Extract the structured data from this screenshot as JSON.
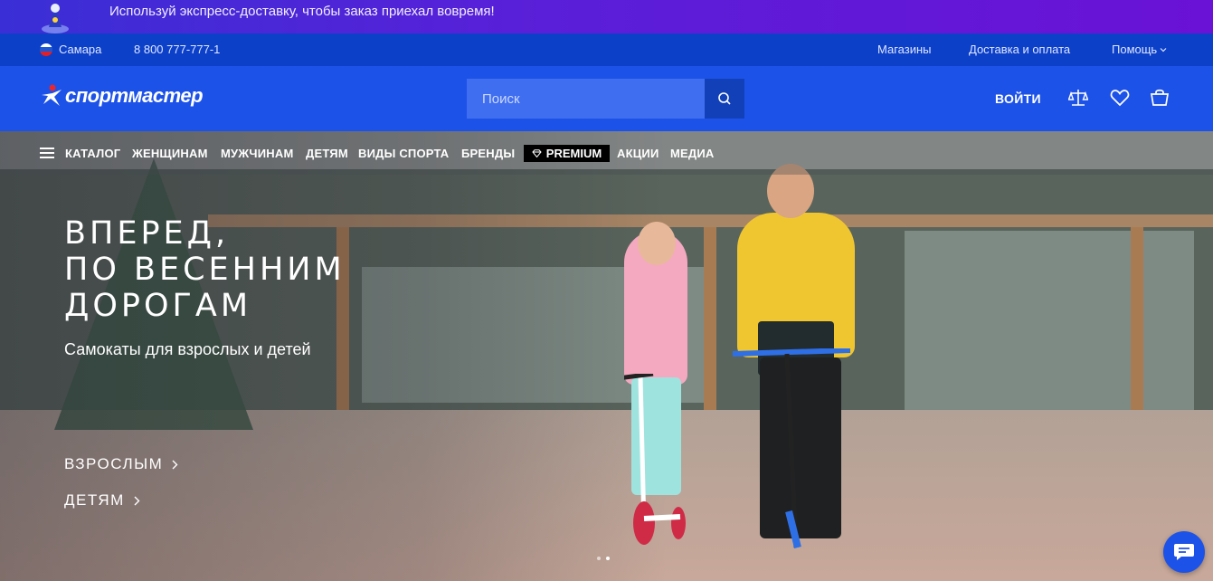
{
  "promo": {
    "text": "Используй экспресс-доставку, чтобы заказ приехал вовремя!"
  },
  "util": {
    "city": "Самара",
    "phone": "8 800 777-777-1",
    "links": [
      "Магазины",
      "Доставка и оплата",
      "Помощь"
    ]
  },
  "header": {
    "logo": "спортмастер",
    "search_placeholder": "Поиск",
    "login": "ВОЙТИ",
    "icons": [
      "compare-icon",
      "heart-icon",
      "cart-icon"
    ]
  },
  "nav": {
    "items": [
      "КАТАЛОГ",
      "ЖЕНЩИНАМ",
      "МУЖЧИНАМ",
      "ДЕТЯМ",
      "ВИДЫ СПОРТА",
      "БРЕНДЫ"
    ],
    "premium": "PREMIUM",
    "items2": [
      "АКЦИИ",
      "МЕДИА"
    ]
  },
  "hero": {
    "title_lines": [
      "ВПЕРЕД,",
      "ПО ВЕСЕННИМ",
      "ДОРОГАМ"
    ],
    "subtitle": "Самокаты для взрослых и детей",
    "links": [
      "ВЗРОСЛЫМ",
      "ДЕТЯМ"
    ]
  },
  "colors": {
    "brand": "#1d52e8",
    "util": "#0c40c9",
    "promo": "#5a1fd8"
  }
}
